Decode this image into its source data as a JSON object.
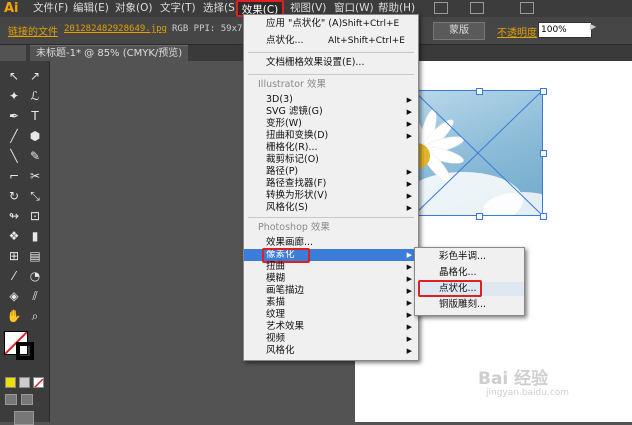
{
  "app": {
    "logo": "Ai"
  },
  "menubar": {
    "items": [
      "文件(F)",
      "编辑(E)",
      "对象(O)",
      "文字(T)",
      "选择(S)",
      "效果(C)",
      "视图(V)",
      "窗口(W)",
      "帮助(H)"
    ]
  },
  "control_bar": {
    "linked_file_label": "链接的文件",
    "filename": "201282482928649.jpg",
    "color_info": "RGB  PPI: 59x70",
    "mask_button": "蒙版",
    "opacity_label": "不透明度",
    "opacity_value": "100%"
  },
  "document_tab": {
    "title": "未标题-1* @ 85% (CMYK/预览)"
  },
  "effect_menu": {
    "apply_last": {
      "label": "应用 \"点状化\" (A)",
      "shortcut": "Shift+Ctrl+E"
    },
    "last_effect": {
      "label": "点状化...",
      "shortcut": "Alt+Shift+Ctrl+E"
    },
    "raster_settings": "文档栅格效果设置(E)...",
    "illustrator_header": "Illustrator 效果",
    "illustrator_items": [
      "3D(3)",
      "SVG 滤镜(G)",
      "变形(W)",
      "扭曲和变换(D)",
      "栅格化(R)...",
      "裁剪标记(O)",
      "路径(P)",
      "路径查找器(F)",
      "转换为形状(V)",
      "风格化(S)"
    ],
    "photoshop_header": "Photoshop 效果",
    "photoshop_items": [
      "效果画廊...",
      "像素化",
      "扭曲",
      "模糊",
      "画笔描边",
      "素描",
      "纹理",
      "艺术效果",
      "视频",
      "风格化"
    ]
  },
  "pixelate_submenu": {
    "items": [
      "彩色半调...",
      "晶格化...",
      "点状化...",
      "铜版雕刻..."
    ]
  },
  "watermark": {
    "text": "Bai 经验",
    "url": "jingyan.baidu.com"
  },
  "colors": {
    "highlight": "#3b7dd8",
    "callout": "#e02020",
    "accent": "#e0a000"
  }
}
